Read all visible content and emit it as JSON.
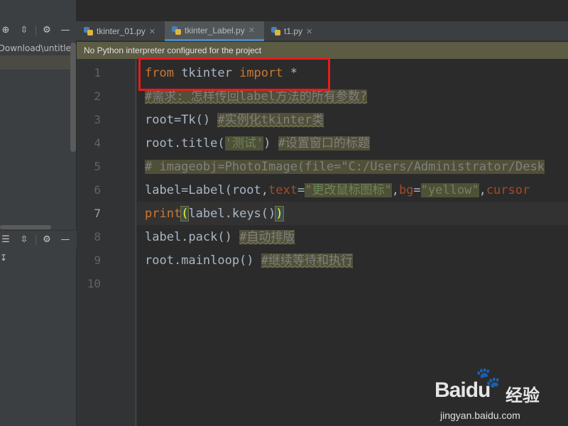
{
  "left_panel": {
    "path_text": "kDownload\\untitle",
    "down_glyph": "↧"
  },
  "tabs": [
    {
      "label": "tkinter_01.py",
      "active": false
    },
    {
      "label": "tkinter_Label.py",
      "active": true
    },
    {
      "label": "t1.py",
      "active": false
    }
  ],
  "banner": "No Python interpreter configured for the project",
  "line_numbers": [
    "1",
    "2",
    "3",
    "4",
    "5",
    "6",
    "7",
    "8",
    "9",
    "10"
  ],
  "code": {
    "l1": {
      "kw1": "from",
      "mid": " tkinter ",
      "kw2": "import",
      "rest": " *"
    },
    "l2": {
      "comment": "#需求: 怎样传回label方法的所有参数?"
    },
    "l3": {
      "code": "root=Tk()",
      "comment": "#实例化tkinter类"
    },
    "l4": {
      "a": "root.title(",
      "str": "'测试'",
      "b": ")",
      "comment": "#设置窗口的标题"
    },
    "l5": {
      "comment": "# imageobj=PhotoImage(file=\"C:/Users/Administrator/Desk"
    },
    "l6": {
      "a": "label=Label(root,",
      "k1": "text",
      "eq1": "=",
      "s1": "\"更改鼠标图标\"",
      "c1": ",",
      "k2": "bg",
      "eq2": "=",
      "s2": "\"yellow\"",
      "c2": ",",
      "k3": "cursor"
    },
    "l7": {
      "kw": "print",
      "open": "(",
      "mid": "label.keys()",
      "close": ")"
    },
    "l8": {
      "code": "label.pack()",
      "comment": "#自动排版"
    },
    "l9": {
      "code": "root.mainloop()",
      "comment": "#继续等待和执行"
    }
  },
  "watermark": {
    "brand": "Bai",
    "brand_du": "du",
    "brand2": "经验",
    "url": "jingyan.baidu.com"
  },
  "colors": {
    "accent": "#4a88c7",
    "highlight": "#e81b1b"
  }
}
